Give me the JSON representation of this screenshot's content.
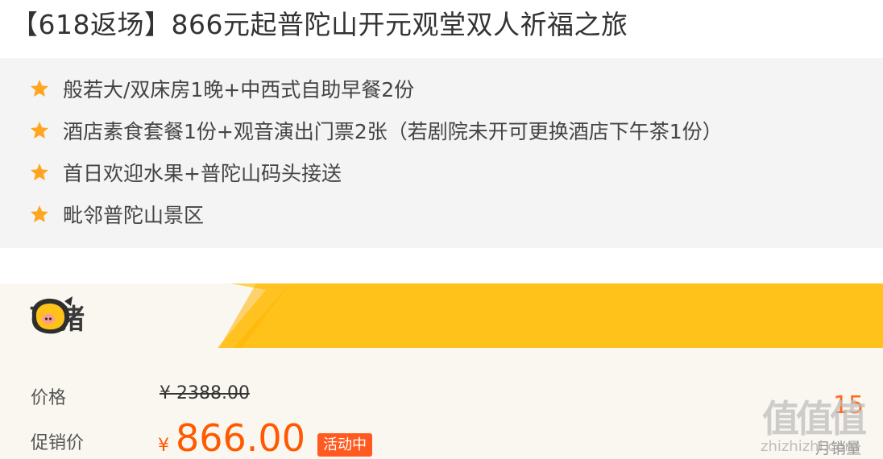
{
  "title": "【618返场】866元起普陀山开元观堂双人祈福之旅",
  "features": [
    "般若大/双床房1晚+中西式自助早餐2份",
    "酒店素食套餐1份+观音演出门票2张（若剧院未开可更换酒店下午茶1份）",
    "首日欢迎水果+普陀山码头接送",
    "毗邻普陀山景区"
  ],
  "feature_icon": "star-icon",
  "colors": {
    "accent": "#ff5a00",
    "banner_yellow": "#ffc21a",
    "star": "#ffa51f",
    "badge": "#ff5a1f"
  },
  "promo": {
    "platform_name": "飞猪",
    "price_label": "价格",
    "original_price": "¥ 2388.00",
    "sale_label": "促销价",
    "currency": "¥",
    "sale_price": "866.00",
    "badge": "活动中",
    "sales_count": "15",
    "sales_label": "月销量"
  },
  "watermark": {
    "logo": "值值值",
    "text": "zhizhizhi.com"
  }
}
